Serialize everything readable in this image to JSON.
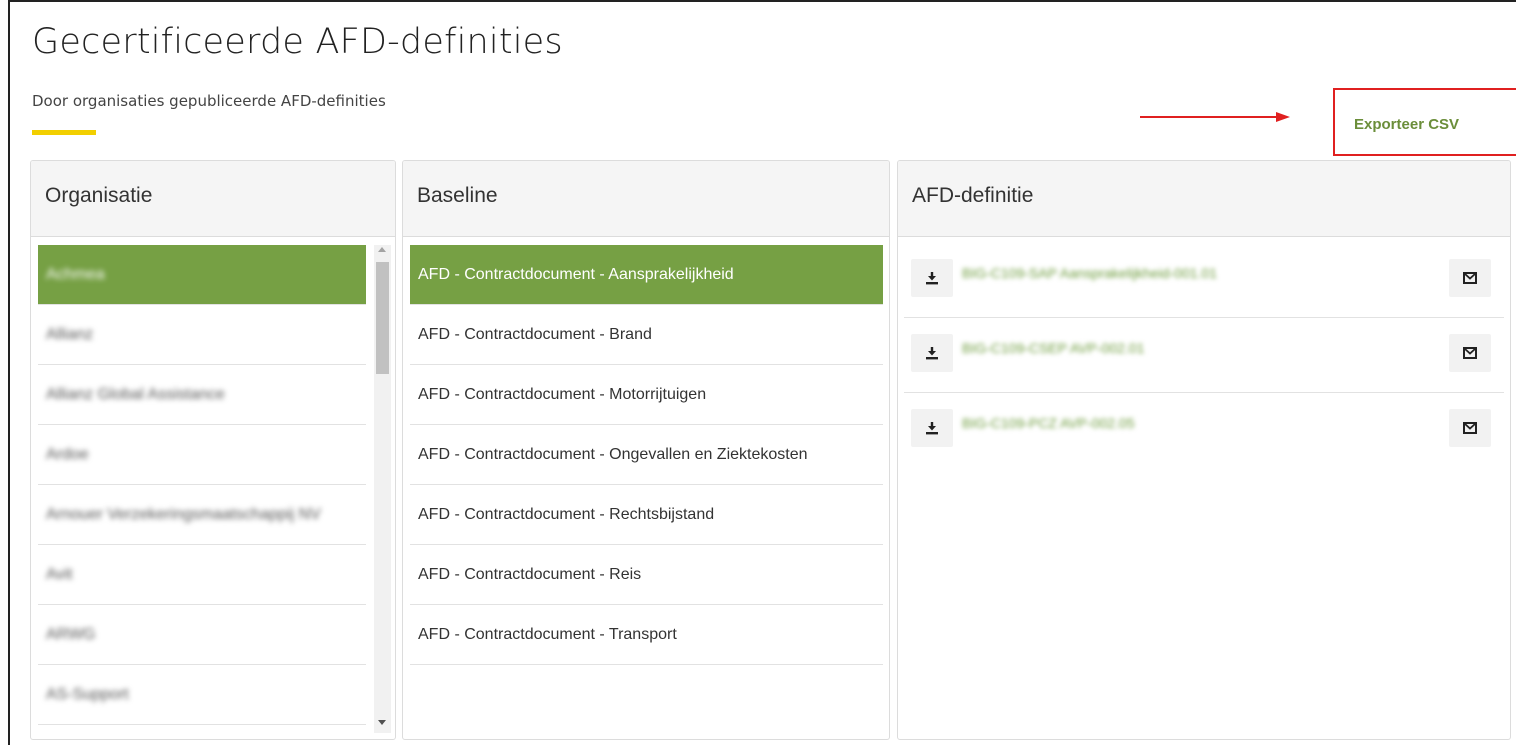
{
  "page": {
    "title": "Gecertificeerde AFD-definities",
    "subtitle": "Door organisaties gepubliceerde AFD-definities",
    "export_label": "Exporteer CSV"
  },
  "colors": {
    "accent_green": "#76a044",
    "link_green": "#6b9a3a",
    "underline_yellow": "#f2cf00",
    "annotation_red": "#e02020"
  },
  "panels": {
    "organisatie": {
      "header": "Organisatie",
      "items": [
        {
          "label": "Achmea",
          "selected": true
        },
        {
          "label": "Allianz",
          "selected": false
        },
        {
          "label": "Allianz Global Assistance",
          "selected": false
        },
        {
          "label": "Ardoe",
          "selected": false
        },
        {
          "label": "Arnouer Verzekeringsmaatschappij NV",
          "selected": false
        },
        {
          "label": "Avit",
          "selected": false
        },
        {
          "label": "ARWG",
          "selected": false
        },
        {
          "label": "AS-Support",
          "selected": false
        }
      ]
    },
    "baseline": {
      "header": "Baseline",
      "items": [
        {
          "label": "AFD - Contractdocument - Aansprakelijkheid",
          "selected": true
        },
        {
          "label": "AFD - Contractdocument - Brand",
          "selected": false
        },
        {
          "label": "AFD - Contractdocument - Motorrijtuigen",
          "selected": false
        },
        {
          "label": "AFD - Contractdocument - Ongevallen en Ziektekosten",
          "selected": false
        },
        {
          "label": "AFD - Contractdocument - Rechtsbijstand",
          "selected": false
        },
        {
          "label": "AFD - Contractdocument - Reis",
          "selected": false
        },
        {
          "label": "AFD - Contractdocument - Transport",
          "selected": false
        }
      ]
    },
    "afd": {
      "header": "AFD-definitie",
      "rows": [
        {
          "label": "BIG-C109-SAP Aansprakelijkheid-001.01",
          "download_icon": "download-icon",
          "mail_icon": "envelope-icon"
        },
        {
          "label": "BIG-C109-CSEP AVP-002.01",
          "download_icon": "download-icon",
          "mail_icon": "envelope-icon"
        },
        {
          "label": "BIG-C109-PCZ AVP-002.05",
          "download_icon": "download-icon",
          "mail_icon": "envelope-icon"
        }
      ]
    }
  }
}
